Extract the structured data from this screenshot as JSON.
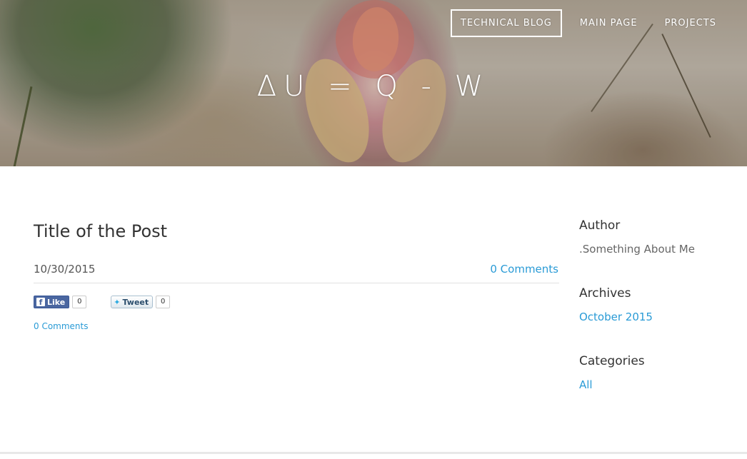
{
  "nav": {
    "items": [
      {
        "label": "TECHNICAL BLOG",
        "active": true
      },
      {
        "label": "MAIN PAGE",
        "active": false
      },
      {
        "label": "PROJECTS",
        "active": false
      }
    ]
  },
  "site": {
    "logo": "ΔU = Q - W"
  },
  "post": {
    "title": "Title of the Post",
    "date": "10/30/2015",
    "comments_top": "0 Comments",
    "comments_bottom": "0 Comments",
    "facebook": {
      "label": "Like",
      "count": "0"
    },
    "twitter": {
      "label": "Tweet",
      "count": "0"
    }
  },
  "sidebar": {
    "author_heading": "Author",
    "author_text": ".Something About Me",
    "archives_heading": "Archives",
    "archives": [
      "October 2015"
    ],
    "categories_heading": "Categories",
    "categories": [
      "All"
    ]
  },
  "colors": {
    "link": "#2a9bd6",
    "nav_text": "#ffffff"
  }
}
